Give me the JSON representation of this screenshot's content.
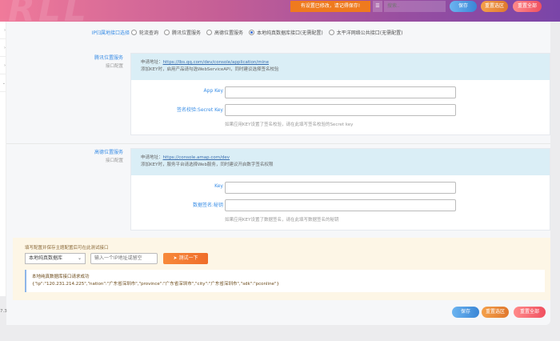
{
  "header": {
    "watermark": "RLL",
    "notice": "有设置已修改，请记得保存!",
    "search_placeholder": "搜索..",
    "save": "保存",
    "reset_section": "重置选区",
    "reset_all": "重置全部"
  },
  "ip_api": {
    "label": "IP归属地接口选择",
    "options": [
      "轮流查询",
      "腾讯位置服务",
      "高德位置服务",
      "本地纯真数据库接口(无需配置)",
      "太平洋网络公共接口(无需配置)"
    ],
    "selected_index": 3
  },
  "tencent": {
    "title": "腾讯位置服务",
    "subtitle": "接口配置",
    "apply_prefix": "申请地址：",
    "apply_url": "https://lbs.qq.com/dev/console/application/mine",
    "note": "添加KEY时，启用产品请勾选WebServiceAPI，同时建议选择签名校验",
    "fields": [
      {
        "label": "App Key",
        "value": ""
      },
      {
        "label": "签名校验:Secret Key",
        "value": "",
        "hint": "如果应用KEY设置了签名校验，请在此填写签名校验的Secret key"
      }
    ]
  },
  "gaode": {
    "title": "高德位置服务",
    "subtitle": "接口配置",
    "apply_prefix": "申请地址：",
    "apply_url": "https://console.amap.com/dev",
    "note": "添加KEY时，服务平台请选择Web服务，同时建议开启数字签名权限",
    "fields": [
      {
        "label": "Key",
        "value": ""
      },
      {
        "label": "数据签名:秘钥",
        "value": "",
        "hint": "如果应用KEY设置了数据签名，请在此填写数据签名的秘钥"
      }
    ]
  },
  "test": {
    "title": "填写配置并保存主题配置后可在此测试接口",
    "select_value": "本地纯真数据库",
    "ip_placeholder": "输入一个IP地址或留空",
    "button": "测试一下",
    "result_title": "本地纯真数据库接口请求成功",
    "result_body": "{\"ip\":\"120.231.214.225\",\"nation\":\"广东省深圳市\",\"province\":\"广东省深圳市\",\"city\":\"广东省深圳市\",\"sdk\":\"pconline\"}"
  },
  "footer": {
    "save": "保存",
    "reset_section": "重置选区",
    "reset_all": "重置全部",
    "version": "7.3"
  }
}
